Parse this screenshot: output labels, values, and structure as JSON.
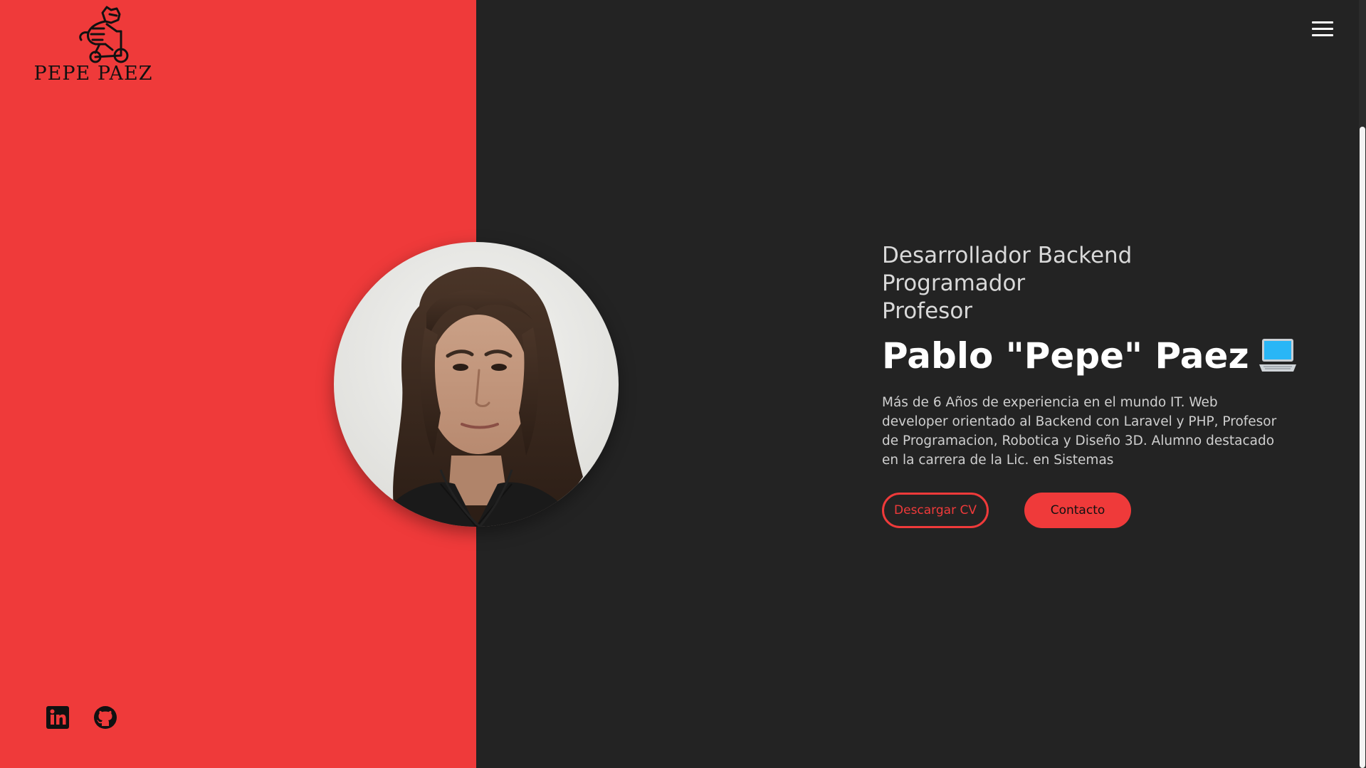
{
  "brand": {
    "logo_text": "PEPE PAEZ",
    "logo_icon": "raccoon-bicycle-logo"
  },
  "nav": {
    "menu_icon": "hamburger-menu-icon"
  },
  "hero": {
    "roles": [
      "Desarrollador Backend",
      "Programador",
      "Profesor"
    ],
    "name": "Pablo \"Pepe\" Paez",
    "name_icon": "laptop-icon",
    "description": "Más de 6 Años de experiencia en el mundo IT. Web developer orientado al Backend con Laravel y PHP, Profesor de Programacion, Robotica y Diseño 3D. Alumno destacado en la carrera de la Lic. en Sistemas",
    "buttons": {
      "download_cv": "Descargar CV",
      "contact": "Contacto"
    },
    "avatar_icon": "profile-photo"
  },
  "socials": [
    {
      "icon": "linkedin-icon"
    },
    {
      "icon": "github-icon"
    }
  ],
  "colors": {
    "accent": "#ef3a3a",
    "background": "#232323",
    "text_primary": "#ffffff",
    "text_secondary": "#cfcfcf"
  }
}
